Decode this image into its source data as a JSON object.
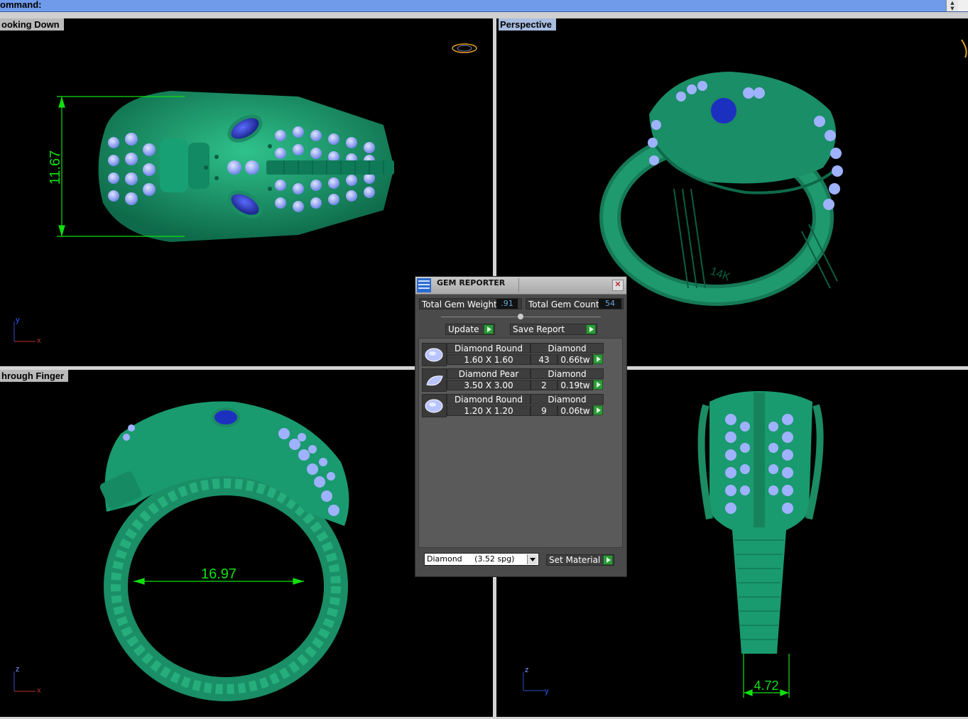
{
  "command_bar": {
    "label": "ommand:"
  },
  "viewports": {
    "top_left": {
      "label": "ooking Down",
      "dimension": "11.67",
      "axis_v": "y",
      "axis_h": "x"
    },
    "top_right": {
      "label": "Perspective"
    },
    "bottom_left": {
      "label": "hrough Finger",
      "dimension": "16.97",
      "axis_v": "z",
      "axis_h": "x"
    },
    "bottom_right": {
      "dimension": "4.72",
      "axis_v": "z",
      "axis_h": "y"
    }
  },
  "gem_reporter": {
    "title": "GEM REPORTER",
    "total_weight_label": "Total Gem Weight",
    "total_weight_value": ".91",
    "total_count_label": "Total Gem Count",
    "total_count_value": "54",
    "update_label": "Update",
    "save_report_label": "Save Report",
    "rows": [
      {
        "name": "Diamond Round",
        "material": "Diamond",
        "size": "1.60 X 1.60",
        "count": "43",
        "weight": "0.66tw",
        "shape": "round"
      },
      {
        "name": "Diamond Pear",
        "material": "Diamond",
        "size": "3.50 X 3.00",
        "count": "2",
        "weight": "0.19tw",
        "shape": "pear"
      },
      {
        "name": "Diamond Round",
        "material": "Diamond",
        "size": "1.20 X 1.20",
        "count": "9",
        "weight": "0.06tw",
        "shape": "round"
      }
    ],
    "material_select": "Diamond     (3.52 spg)",
    "set_material_label": "Set Material"
  },
  "colors": {
    "metal": "#1f9a6e",
    "gem_round": "#9fb2ff",
    "gem_pear": "#2a2fb0",
    "dimension": "#10e010"
  }
}
